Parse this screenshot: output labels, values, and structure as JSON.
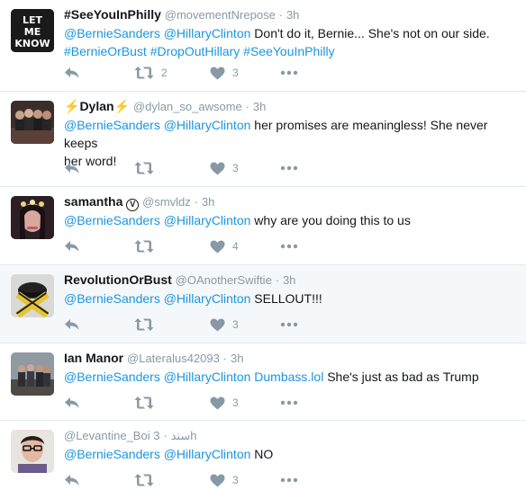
{
  "tweets": [
    {
      "name": "#SeeYouInPhilly",
      "handle": "@movementNrepose",
      "dot": "·",
      "time": "3h",
      "line1": [
        {
          "t": "@BernieSanders @HillaryClinton",
          "link": true
        },
        {
          "t": " Don't do it, Bernie... She's not on our side.",
          "link": false
        }
      ],
      "line2": [
        {
          "t": "#BernieOrBust #DropOutHillary #SeeYouInPhilly",
          "link": true
        }
      ],
      "retweets": "2",
      "likes": "3",
      "avatar_text": "LET ME KNOW"
    },
    {
      "name_prefix": "⚡",
      "name": "Dylan",
      "name_suffix": "⚡",
      "handle": "@dylan_so_awsome",
      "dot": "·",
      "time": "3h",
      "line1": [
        {
          "t": "@BernieSanders @HillaryClinton",
          "link": true
        },
        {
          "t": " her promises are meaningless! She never keeps",
          "link": false
        }
      ],
      "line2": [
        {
          "t": "her word!",
          "link": false
        }
      ],
      "retweets": "",
      "likes": "3"
    },
    {
      "name": "samantha",
      "verified_glyph": "V",
      "handle": "@smvldz",
      "dot": "·",
      "time": "3h",
      "line1": [
        {
          "t": "@BernieSanders @HillaryClinton",
          "link": true
        },
        {
          "t": " why are you doing this to us",
          "link": false
        }
      ],
      "retweets": "",
      "likes": "4"
    },
    {
      "name": "RevolutionOrBust",
      "handle": "@OAnotherSwiftie",
      "dot": "·",
      "time": "3h",
      "line1": [
        {
          "t": "@BernieSanders @HillaryClinton",
          "link": true
        },
        {
          "t": " SELLOUT!!!",
          "link": false
        }
      ],
      "retweets": "",
      "likes": "3"
    },
    {
      "name": "Ian Manor",
      "handle": "@Lateralus42093",
      "dot": "·",
      "time": "3h",
      "line1": [
        {
          "t": "@BernieSanders @HillaryClinton Dumbass.lol",
          "link": true
        },
        {
          "t": " She's just as bad as Trump",
          "link": false
        }
      ],
      "retweets": "",
      "likes": "3"
    },
    {
      "name": "",
      "handle": "@Levantine_Boi سند",
      "dot": "·",
      "time": "3h",
      "line1": [
        {
          "t": "@BernieSanders @HillaryClinton",
          "link": true
        },
        {
          "t": " NO",
          "link": false
        }
      ],
      "retweets": "",
      "likes": "3"
    }
  ],
  "colors": {
    "link": "#1b95e0",
    "meta": "#8899a6",
    "highlight_bg": "#f5f8fa",
    "divider": "#e1e8ed"
  }
}
